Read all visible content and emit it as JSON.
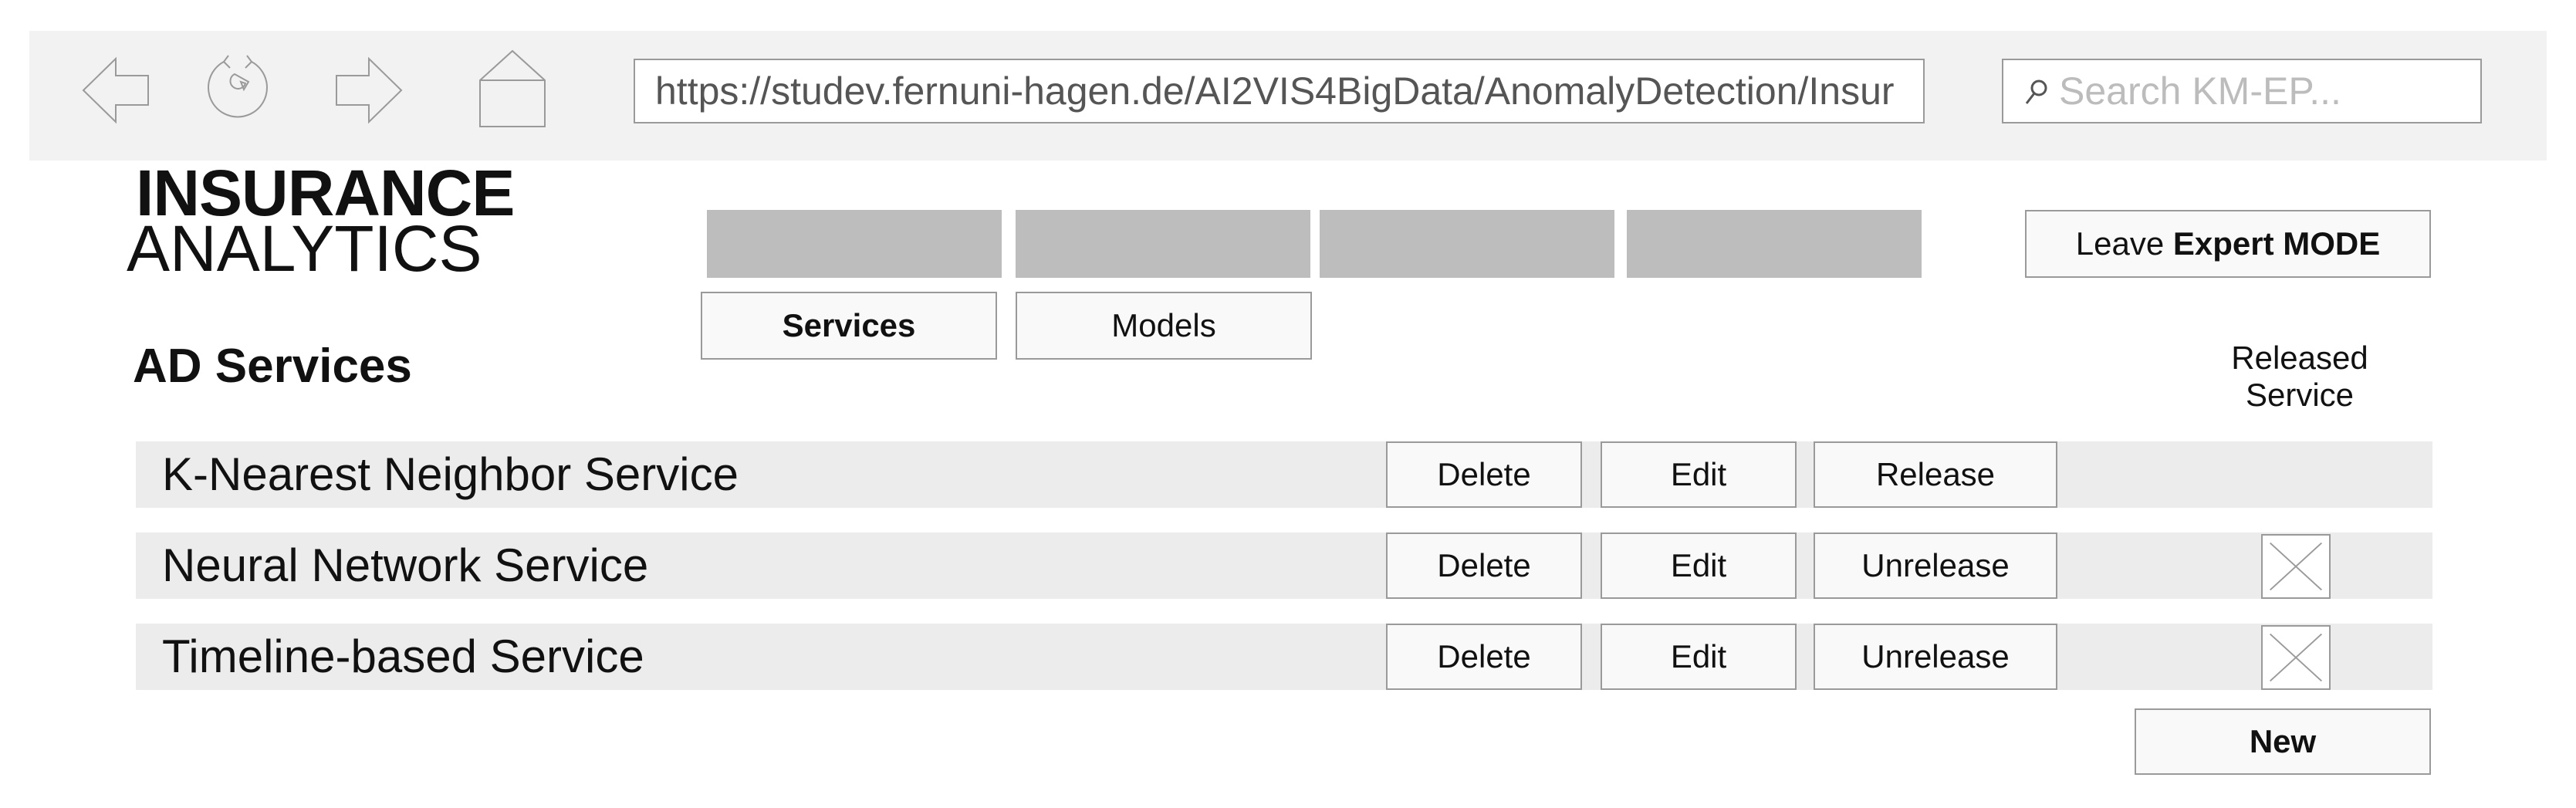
{
  "browser": {
    "url": "https://studev.fernuni-hagen.de/AI2VIS4BigData/AnomalyDetection/Insur",
    "search_placeholder": "Search KM-EP...",
    "icons": [
      "back-arrow-icon",
      "reload-icon",
      "forward-arrow-icon",
      "home-icon"
    ]
  },
  "logo": {
    "line1": "INSURANCE",
    "line2": "ANALYTICS"
  },
  "header": {
    "leave_prefix": "Leave ",
    "leave_bold": "Expert MODE"
  },
  "subtabs": [
    {
      "label": "Services",
      "active": true
    },
    {
      "label": "Models",
      "active": false
    }
  ],
  "page": {
    "title": "AD Services",
    "released_header": "Released Service"
  },
  "services": [
    {
      "name": "K-Nearest Neighbor Service",
      "delete": "Delete",
      "edit": "Edit",
      "release_action": "Release",
      "released": false
    },
    {
      "name": "Neural Network Service",
      "delete": "Delete",
      "edit": "Edit",
      "release_action": "Unrelease",
      "released": true
    },
    {
      "name": "Timeline-based Service",
      "delete": "Delete",
      "edit": "Edit",
      "release_action": "Unrelease",
      "released": true
    }
  ],
  "new_button": "New",
  "colors": {
    "bar": "#f2f2f2",
    "row": "#ececec",
    "tab_placeholder": "#bdbdbd",
    "border": "#9a9a9a"
  }
}
